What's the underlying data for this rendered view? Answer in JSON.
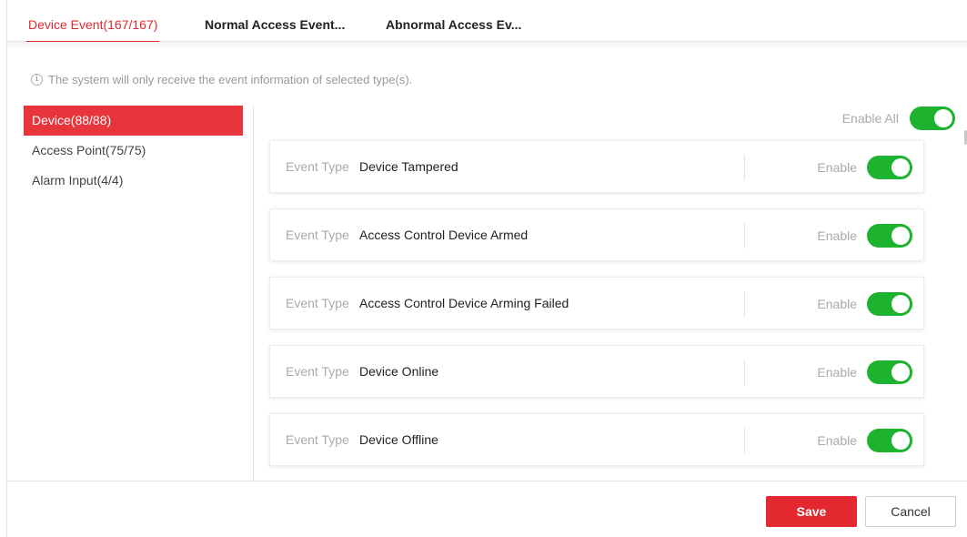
{
  "tabs": [
    {
      "label": "Device Event(167/167)",
      "active": true
    },
    {
      "label": "Normal Access Event...",
      "active": false
    },
    {
      "label": "Abnormal Access Ev...",
      "active": false
    }
  ],
  "info": {
    "icon": "info-icon",
    "text": "The system will only receive the event information of selected type(s)."
  },
  "menu": [
    {
      "label": "Device(88/88)",
      "active": true
    },
    {
      "label": "Access Point(75/75)",
      "active": false
    },
    {
      "label": "Alarm Input(4/4)",
      "active": false
    }
  ],
  "enable_all": {
    "label": "Enable All",
    "on": true
  },
  "event_type_label": "Event Type",
  "enable_label": "Enable",
  "events": [
    {
      "type": "Device Tampered",
      "enabled": true
    },
    {
      "type": "Access Control Device Armed",
      "enabled": true
    },
    {
      "type": "Access Control Device Arming Failed",
      "enabled": true
    },
    {
      "type": "Device Online",
      "enabled": true
    },
    {
      "type": "Device Offline",
      "enabled": true
    }
  ],
  "footer": {
    "save_label": "Save",
    "cancel_label": "Cancel"
  },
  "colors": {
    "accent": "#e4282f",
    "toggle_on": "#1db32f"
  }
}
